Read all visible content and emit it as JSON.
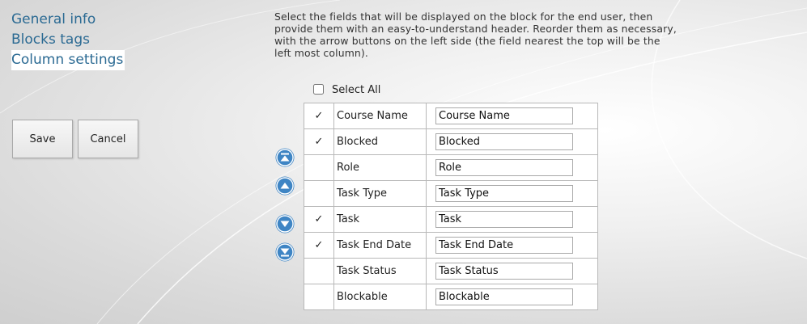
{
  "nav": {
    "items": [
      {
        "label": "General info",
        "active": false
      },
      {
        "label": "Blocks tags",
        "active": false
      },
      {
        "label": "Column settings",
        "active": true
      }
    ]
  },
  "buttons": {
    "save_label": "Save",
    "cancel_label": "Cancel"
  },
  "description": "Select the fields that will be displayed on the block for the end user, then provide them with an easy-to-understand header. Reorder them as necessary, with the arrow buttons on the left side (the field nearest the top will be the left most column).",
  "select_all": {
    "label": "Select All",
    "checked": false
  },
  "arrows": [
    "move-to-top-icon",
    "move-up-icon",
    "move-down-icon",
    "move-to-bottom-icon"
  ],
  "colors": {
    "accent": "#3f85c4",
    "link": "#2b6a93"
  },
  "rows": [
    {
      "check": "✓",
      "field": "Course Name",
      "header": "Course Name"
    },
    {
      "check": "✓",
      "field": "Blocked",
      "header": "Blocked"
    },
    {
      "check": "",
      "field": "Role",
      "header": "Role"
    },
    {
      "check": "",
      "field": "Task Type",
      "header": "Task Type"
    },
    {
      "check": "✓",
      "field": "Task",
      "header": "Task"
    },
    {
      "check": "✓",
      "field": "Task End Date",
      "header": "Task End Date"
    },
    {
      "check": "",
      "field": "Task Status",
      "header": "Task Status"
    },
    {
      "check": "",
      "field": "Blockable",
      "header": "Blockable"
    }
  ]
}
